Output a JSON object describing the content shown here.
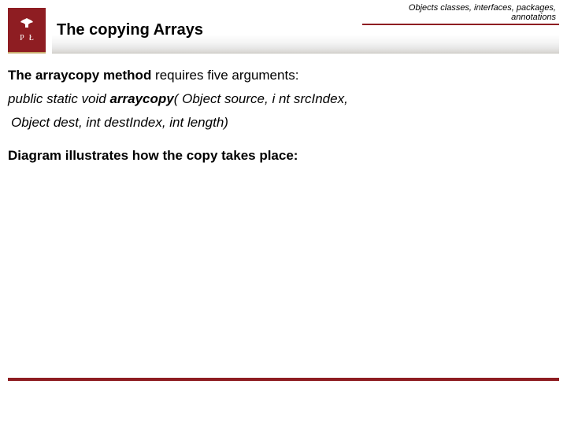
{
  "colors": {
    "brand": "#8e1d22"
  },
  "logo": {
    "icon": "eagle-icon",
    "letters_left": "P",
    "letters_right": "Ł"
  },
  "header": {
    "title": "The copying Arrays",
    "breadcrumb_line1": "Objects classes, interfaces, packages,",
    "breadcrumb_line2": "annotations"
  },
  "body": {
    "intro_prefix_bold": "The arraycopy method",
    "intro_suffix": " requires five arguments:",
    "signature_line1_prefix": "public static void ",
    "signature_line1_bold": "arraycopy",
    "signature_line1_suffix": "( Object source, i nt srcIndex,",
    "signature_line2": "Object dest, int destIndex, int length)",
    "diagram_caption": "Diagram illustrates how the copy takes place:"
  }
}
